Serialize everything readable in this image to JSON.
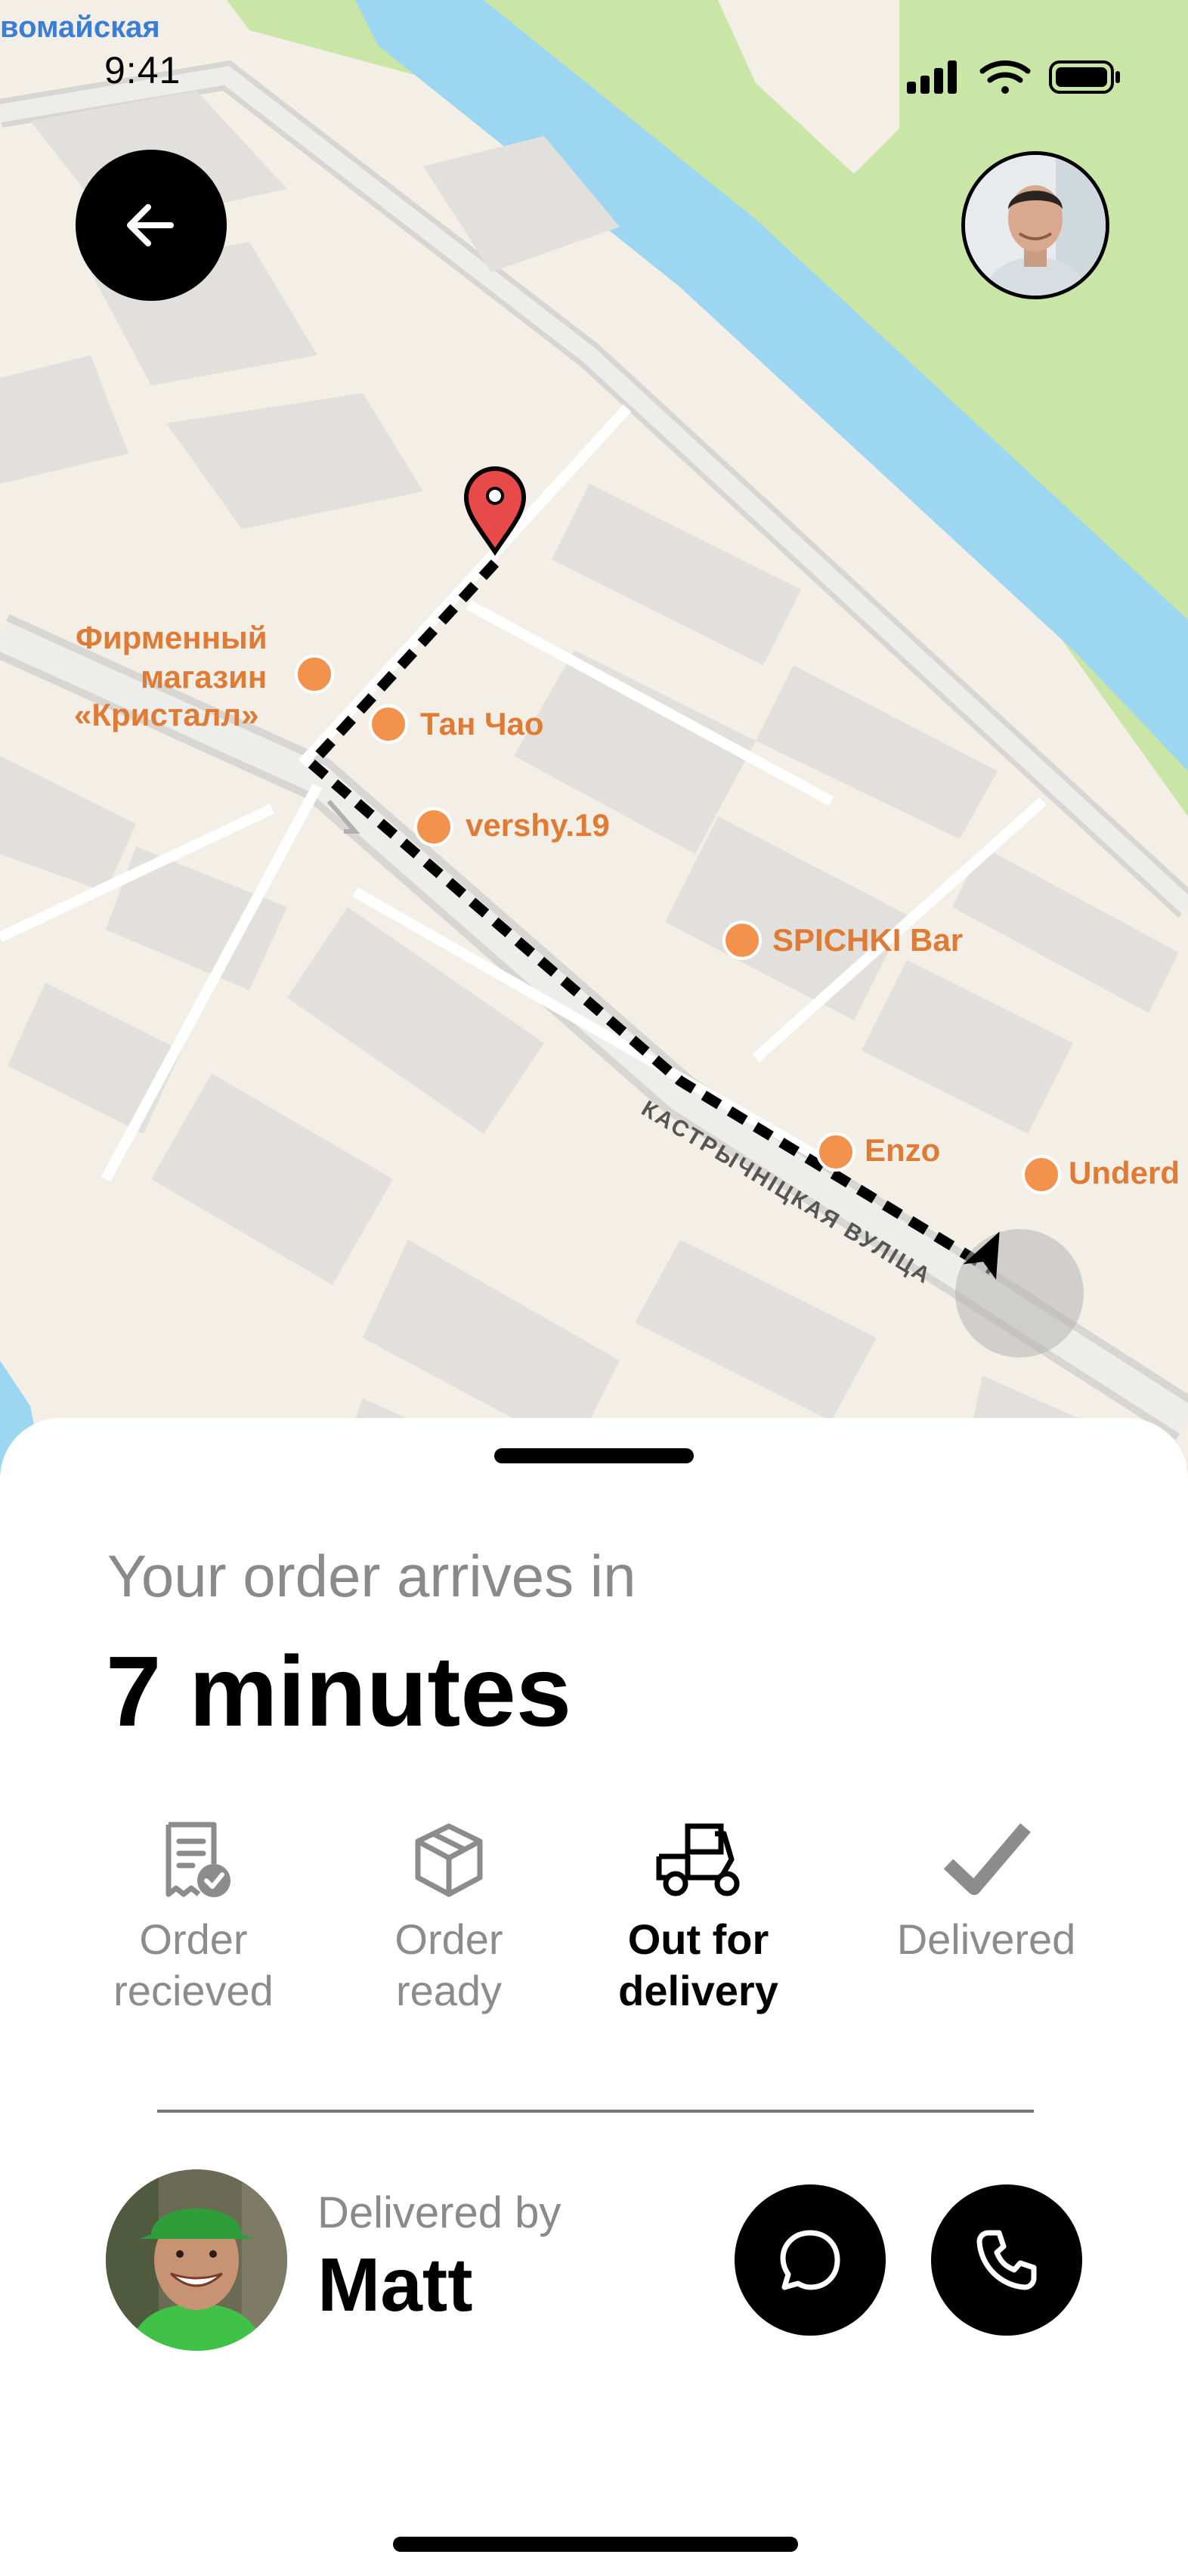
{
  "status_bar": {
    "time": "9:41",
    "location_label": "вомайская"
  },
  "map": {
    "labels": {
      "kristall_1": "Фирменный",
      "kristall_2": "магазин",
      "kristall_3": "«Кристалл»",
      "tan_chao": "Тан Чао",
      "vershy": "vershy.19",
      "spichki": "SPICHKI Bar",
      "enzo": "Enzo",
      "underd": "Underd",
      "street": "КАСТРЫЧНІЦКАЯ ВУЛІЦА"
    },
    "colors": {
      "river": "#9dd6f0",
      "park": "#c9e6a6",
      "route": "#000000",
      "pin": "#e84a4a"
    }
  },
  "sheet": {
    "subtitle": "Your order arrives in",
    "eta": "7 minutes",
    "steps": [
      {
        "label": "Order\nrecieved",
        "icon": "receipt-check-icon",
        "state": "done"
      },
      {
        "label": "Order\nready",
        "icon": "box-icon",
        "state": "done"
      },
      {
        "label": "Out for\ndelivery",
        "icon": "delivery-scooter-icon",
        "state": "active"
      },
      {
        "label": "Delivered",
        "icon": "checkmark-icon",
        "state": "pending"
      }
    ],
    "courier": {
      "caption": "Delivered by",
      "name": "Matt"
    }
  }
}
